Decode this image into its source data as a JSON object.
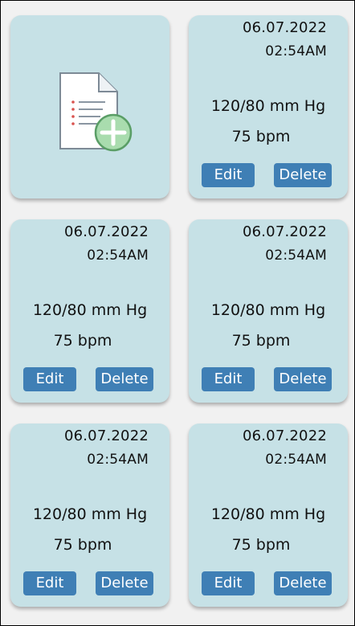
{
  "add_card": {
    "icon": "add-document-icon"
  },
  "records": [
    {
      "date": "06.07.2022",
      "time": "02:54AM",
      "pressure": "120/80 mm Hg",
      "pulse": "75 bpm",
      "edit_label": "Edit",
      "delete_label": "Delete"
    },
    {
      "date": "06.07.2022",
      "time": "02:54AM",
      "pressure": "120/80 mm Hg",
      "pulse": "75 bpm",
      "edit_label": "Edit",
      "delete_label": "Delete"
    },
    {
      "date": "06.07.2022",
      "time": "02:54AM",
      "pressure": "120/80 mm Hg",
      "pulse": "75 bpm",
      "edit_label": "Edit",
      "delete_label": "Delete"
    },
    {
      "date": "06.07.2022",
      "time": "02:54AM",
      "pressure": "120/80 mm Hg",
      "pulse": "75 bpm",
      "edit_label": "Edit",
      "delete_label": "Delete"
    },
    {
      "date": "06.07.2022",
      "time": "02:54AM",
      "pressure": "120/80 mm Hg",
      "pulse": "75 bpm",
      "edit_label": "Edit",
      "delete_label": "Delete"
    }
  ],
  "colors": {
    "card_background": "#c6e1e6",
    "button": "#3f7fb5",
    "page_background": "#f1f1f1"
  }
}
